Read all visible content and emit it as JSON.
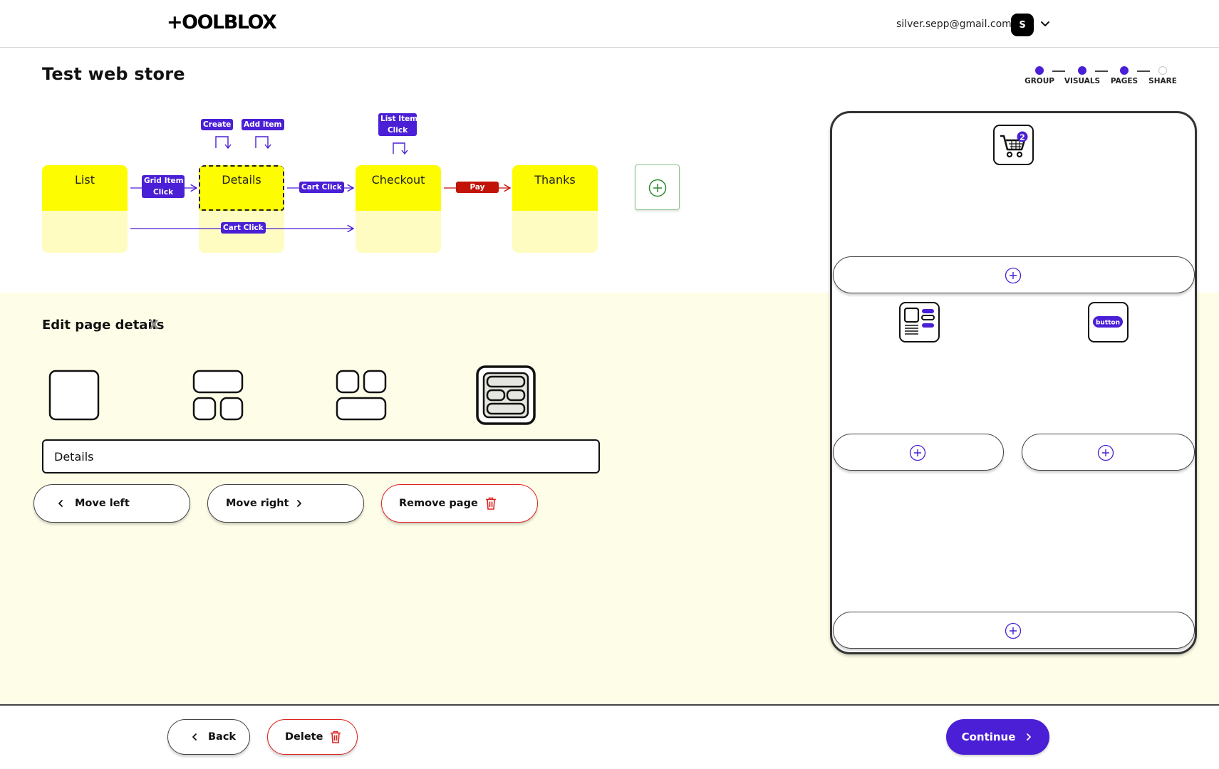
{
  "header": {
    "logo": "+OOLBLOX",
    "user_email": "silver.sepp@gmail.com",
    "avatar_initial": "S"
  },
  "page_title": "Test web store",
  "stepper": {
    "steps": [
      {
        "label": "GROUP",
        "done": true
      },
      {
        "label": "VISUALS",
        "done": true
      },
      {
        "label": "PAGES",
        "done": true
      },
      {
        "label": "SHARE",
        "done": false
      }
    ]
  },
  "flow": {
    "pages": [
      {
        "name": "List",
        "selected": false
      },
      {
        "name": "Details",
        "selected": true
      },
      {
        "name": "Checkout",
        "selected": false
      },
      {
        "name": "Thanks",
        "selected": false
      }
    ],
    "events": {
      "create": "Create",
      "add_item": "Add item",
      "list_item_click": [
        "List Item",
        "Click"
      ],
      "grid_item_click": [
        "Grid Item",
        "Click"
      ],
      "cart_click_top": "Cart Click",
      "cart_click_bottom": "Cart Click",
      "pay": "Pay"
    }
  },
  "edit": {
    "title": "Edit page details",
    "close": "X",
    "page_name_value": "Details",
    "page_name_placeholder": "",
    "move_left_label": "Move left",
    "move_right_label": "Move right",
    "remove_page_label": "Remove page",
    "selected_layout_index": 3
  },
  "phone_preview": {
    "cart_badge_count": "2",
    "button_widget_label": "button"
  },
  "footer": {
    "back_label": "Back",
    "delete_label": "Delete",
    "continue_label": "Continue"
  },
  "colors": {
    "accent": "#4a1fd6",
    "danger": "#c21308",
    "page_header_yellow": "#fefc00",
    "page_body_yellow": "#fefcc0",
    "edit_bg": "#fefee8"
  }
}
